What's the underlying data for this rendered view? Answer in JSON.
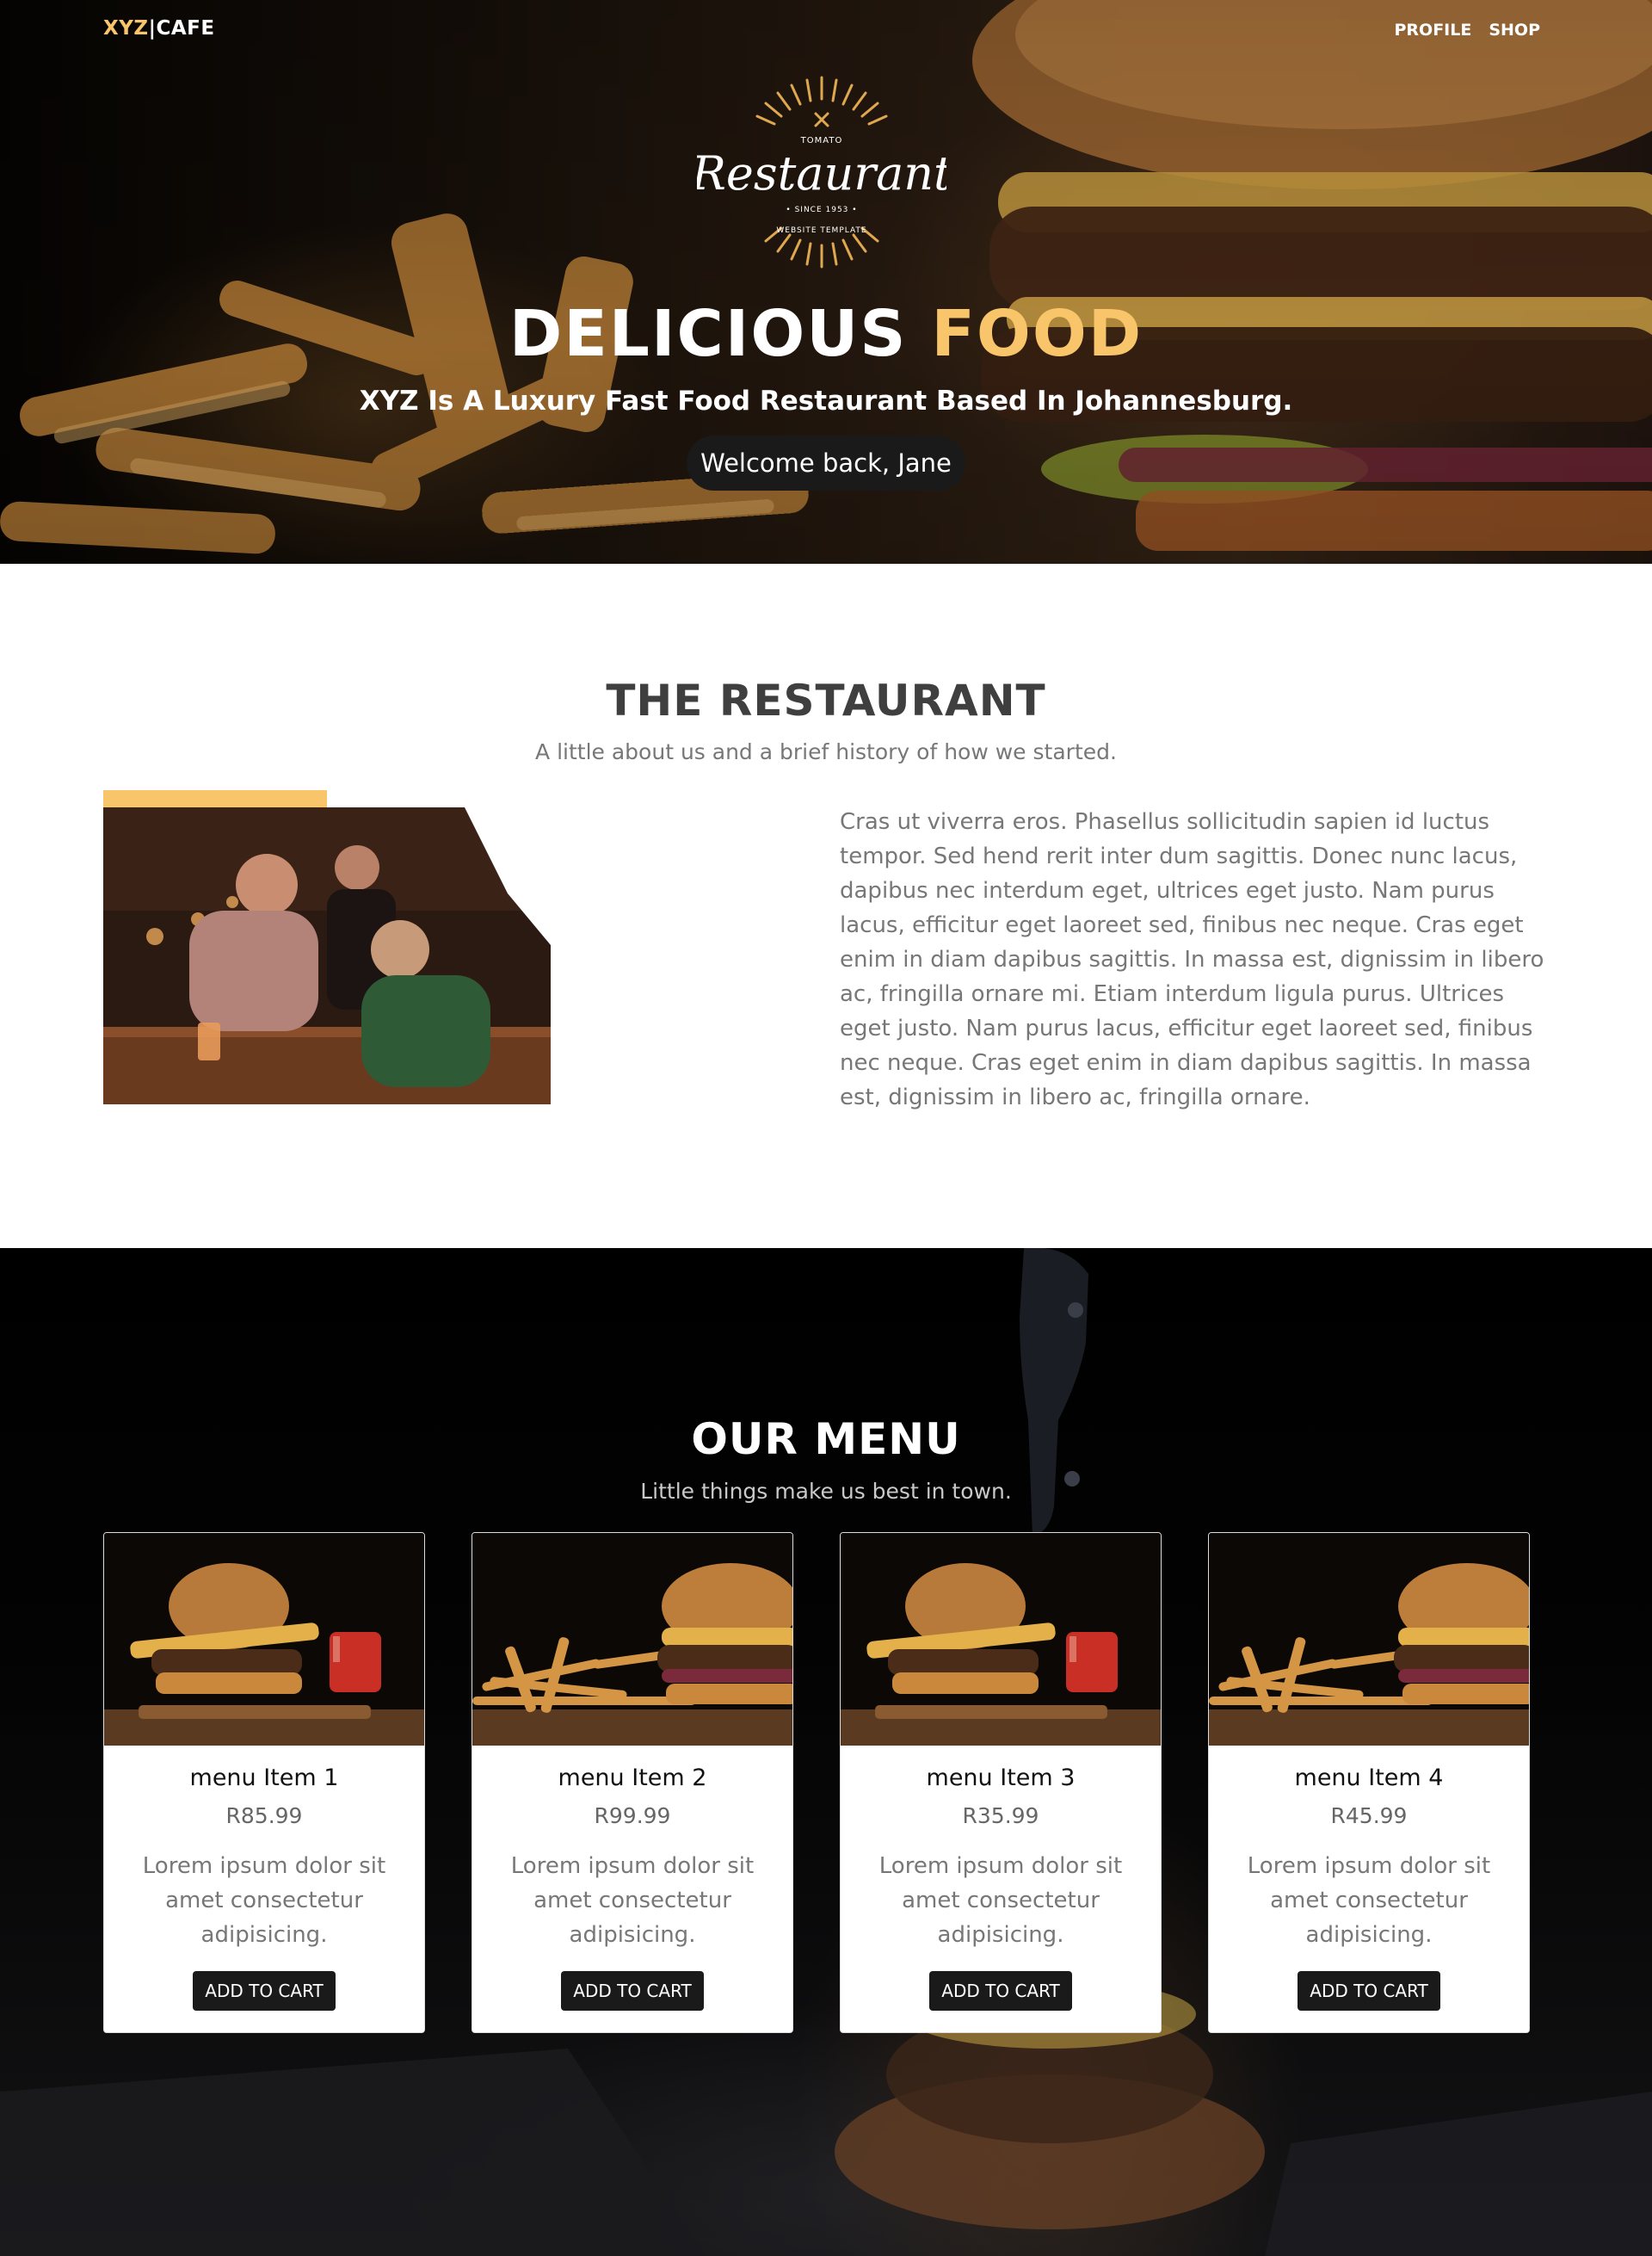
{
  "nav": {
    "brand_accent": "XYZ",
    "brand_rest": "|CAFE",
    "links": [
      "PROFILE",
      "SHOP"
    ]
  },
  "hero": {
    "logo": {
      "top_text": "TOMATO",
      "script_text": "Restaurant",
      "since_text": "• SINCE 1953 •",
      "bottom_text": "WEBSITE TEMPLATE"
    },
    "title_white": "DELICIOUS ",
    "title_gold": "FOOD",
    "subtitle": "XYZ Is A Luxury Fast Food Restaurant Based In Johannesburg.",
    "welcome": "Welcome back, Jane"
  },
  "about": {
    "title": "THE RESTAURANT",
    "subtitle": "A little about us and a brief history of how we started.",
    "body": "Cras ut viverra eros. Phasellus sollicitudin sapien id luctus tempor. Sed hend rerit inter dum sagittis. Donec nunc lacus, dapibus nec interdum eget, ultrices eget justo. Nam purus lacus, efficitur eget laoreet sed, finibus nec neque. Cras eget enim in diam dapibus sagittis. In massa est, dignissim in libero ac, fringilla ornare mi. Etiam interdum ligula purus. Ultrices eget justo. Nam purus lacus, efficitur eget laoreet sed, finibus nec neque. Cras eget enim in diam dapibus sagittis. In massa est, dignissim in libero ac, fringilla ornare."
  },
  "menu": {
    "title": "OUR MENU",
    "subtitle": "Little things make us best in town.",
    "items": [
      {
        "name": "menu Item 1",
        "price": "R85.99",
        "desc": "Lorem ipsum dolor sit amet consectetur adipisicing.",
        "button": "ADD TO CART"
      },
      {
        "name": "menu Item 2",
        "price": "R99.99",
        "desc": "Lorem ipsum dolor sit amet consectetur adipisicing.",
        "button": "ADD TO CART"
      },
      {
        "name": "menu Item 3",
        "price": "R35.99",
        "desc": "Lorem ipsum dolor sit amet consectetur adipisicing.",
        "button": "ADD TO CART"
      },
      {
        "name": "menu Item 4",
        "price": "R45.99",
        "desc": "Lorem ipsum dolor sit amet consectetur adipisicing.",
        "button": "ADD TO CART"
      }
    ]
  },
  "colors": {
    "accent_gold": "#f9c56a",
    "dark": "#1a1a1a",
    "heading_gray": "#3f3f3f",
    "text_gray": "#777777"
  }
}
